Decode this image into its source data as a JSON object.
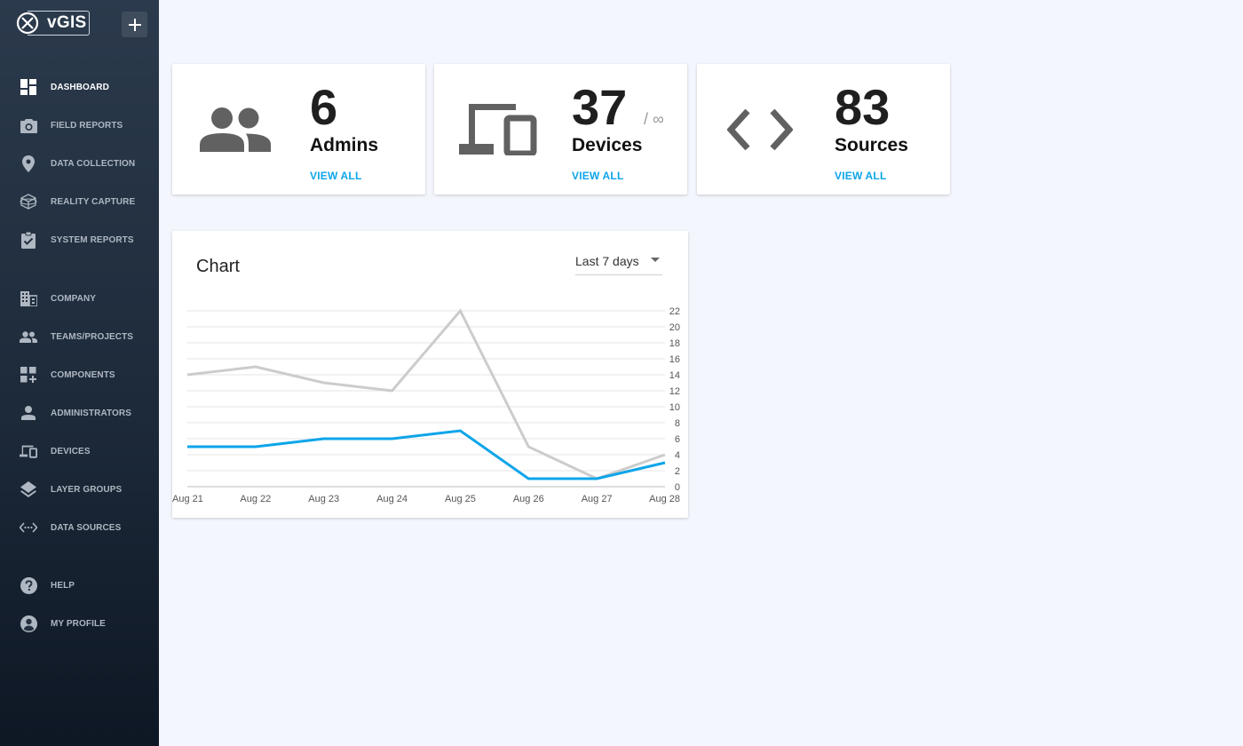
{
  "app": {
    "logo_text": "vGIS",
    "add_button_label": "+"
  },
  "sidebar": {
    "items": [
      {
        "label": "DASHBOARD",
        "icon": "dashboard-icon",
        "active": true
      },
      {
        "label": "FIELD REPORTS",
        "icon": "camera-icon"
      },
      {
        "label": "DATA COLLECTION",
        "icon": "location-pin-icon"
      },
      {
        "label": "REALITY CAPTURE",
        "icon": "cube-icon"
      },
      {
        "label": "SYSTEM REPORTS",
        "icon": "clipboard-check-icon"
      },
      {
        "label": "COMPANY",
        "icon": "building-icon"
      },
      {
        "label": "TEAMS/PROJECTS",
        "icon": "people-icon"
      },
      {
        "label": "COMPONENTS",
        "icon": "widgets-add-icon"
      },
      {
        "label": "ADMINISTRATORS",
        "icon": "person-icon"
      },
      {
        "label": "DEVICES",
        "icon": "devices-icon"
      },
      {
        "label": "LAYER GROUPS",
        "icon": "layers-icon"
      },
      {
        "label": "DATA SOURCES",
        "icon": "settings-ethernet-icon"
      },
      {
        "label": "HELP",
        "icon": "help-icon"
      },
      {
        "label": "MY PROFILE",
        "icon": "account-circle-icon"
      }
    ]
  },
  "stats": {
    "admins": {
      "value": "6",
      "label": "Admins",
      "link": "VIEW ALL",
      "icon": "people-icon"
    },
    "devices": {
      "value": "37",
      "suffix": "/ ∞",
      "label": "Devices",
      "link": "VIEW ALL",
      "icon": "devices-icon"
    },
    "sources": {
      "value": "83",
      "label": "Sources",
      "link": "VIEW ALL",
      "icon": "code-brackets-icon"
    }
  },
  "chart": {
    "title": "Chart",
    "range_selected": "Last 7 days"
  },
  "colors": {
    "accent": "#0ea5ea",
    "series_gray": "#cccccc",
    "sidebar_top": "#2b3a4c",
    "sidebar_bottom": "#0e1724",
    "page_bg": "#f3f6fc"
  },
  "chart_data": {
    "type": "line",
    "title": "Chart",
    "x": [
      "Aug 21",
      "Aug 22",
      "Aug 23",
      "Aug 24",
      "Aug 25",
      "Aug 26",
      "Aug 27",
      "Aug 28"
    ],
    "series": [
      {
        "values": [
          14,
          15,
          13,
          12,
          22,
          5,
          1,
          4
        ],
        "color": "#cccccc"
      },
      {
        "values": [
          5,
          5,
          6,
          6,
          7,
          1,
          1,
          3
        ],
        "color": "#0ea5ea"
      }
    ],
    "y_ticks": [
      "0",
      "2",
      "4",
      "6",
      "8",
      "10",
      "12",
      "14",
      "16",
      "18",
      "20",
      "22"
    ],
    "ylim": [
      0,
      22
    ],
    "y_axis_position": "right",
    "grid": true,
    "legend": false
  }
}
